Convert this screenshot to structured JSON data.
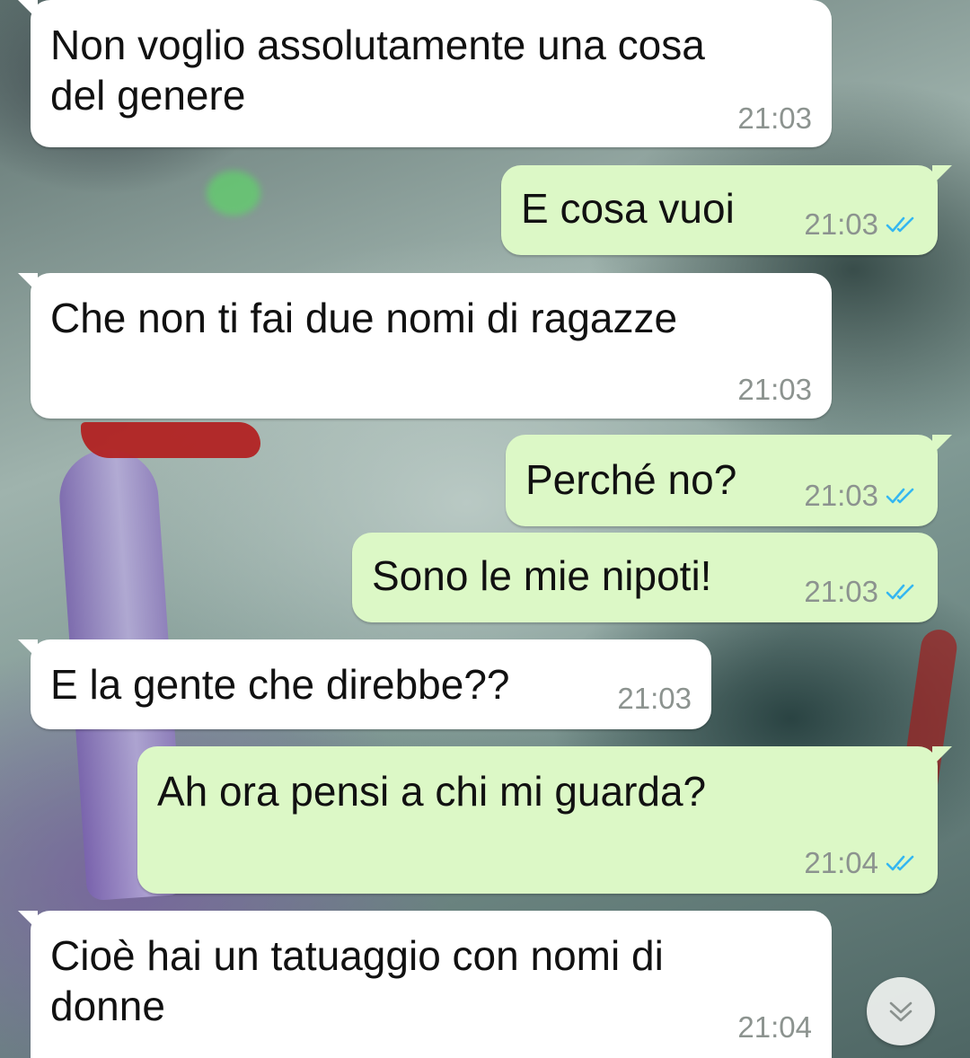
{
  "chat": {
    "messages": [
      {
        "direction": "incoming",
        "text_lines": [
          "Non voglio assolutamente una cosa",
          "del genere"
        ],
        "time": "21:03"
      },
      {
        "direction": "outgoing",
        "text_lines": [
          "E cosa vuoi"
        ],
        "time": "21:03",
        "status": "read"
      },
      {
        "direction": "incoming",
        "text_lines": [
          "Che non ti fai due nomi di ragazze"
        ],
        "time": "21:03"
      },
      {
        "direction": "outgoing",
        "text_lines": [
          "Perché no?"
        ],
        "time": "21:03",
        "status": "read"
      },
      {
        "direction": "outgoing",
        "text_lines": [
          "Sono le mie nipoti!"
        ],
        "time": "21:03",
        "status": "read"
      },
      {
        "direction": "incoming",
        "text_lines": [
          "E la gente che direbbe??"
        ],
        "time": "21:03"
      },
      {
        "direction": "outgoing",
        "text_lines": [
          "Ah ora pensi a chi mi guarda?"
        ],
        "time": "21:04",
        "status": "read"
      },
      {
        "direction": "incoming",
        "text_lines": [
          "Cioè hai un tatuaggio con nomi di",
          "donne"
        ],
        "time": "21:04"
      }
    ]
  },
  "icons": {
    "read_receipt": "double-check-icon",
    "scroll_down": "chevron-double-down-icon"
  },
  "colors": {
    "incoming_bubble": "#ffffff",
    "outgoing_bubble": "#dcf8c6",
    "read_tick": "#34b7f1",
    "timestamp": "#8c938f"
  }
}
